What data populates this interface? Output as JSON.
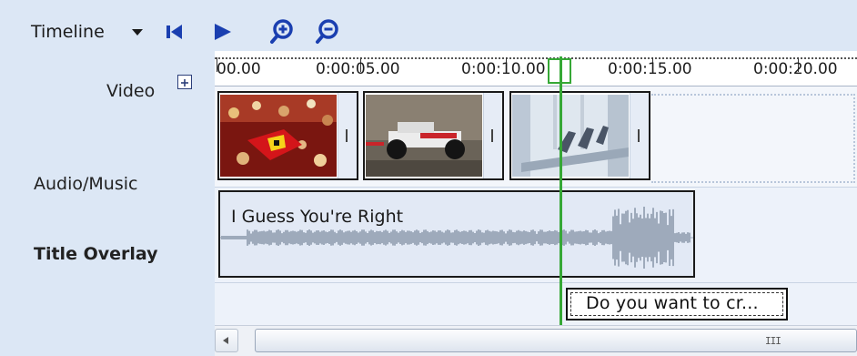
{
  "toolbar": {
    "label": "Timeline",
    "buttons": {
      "dropdown": "chevron-down-icon",
      "rewind": "skip-to-start-icon",
      "play": "play-icon",
      "zoom_in": "zoom-in-icon",
      "zoom_out": "zoom-out-icon"
    }
  },
  "ruler": {
    "ticks": [
      "00.00",
      "0:00:05.00",
      "0:00:10.00",
      "0:00:15.00",
      "0:00:20.00"
    ]
  },
  "tracks": {
    "video": {
      "label": "Video",
      "expand_icon": "plus-box-icon"
    },
    "audio": {
      "label": "Audio/Music",
      "clip_name": "I Guess You're Right"
    },
    "title": {
      "label": "Title Overlay",
      "clip_text": "Do you want to cr..."
    }
  },
  "colors": {
    "background": "#dce7f5",
    "track": "#edf2fa",
    "playhead": "#36a836",
    "icon_blue": "#1a3fb0"
  },
  "scrollbar": {
    "grip": "III"
  }
}
